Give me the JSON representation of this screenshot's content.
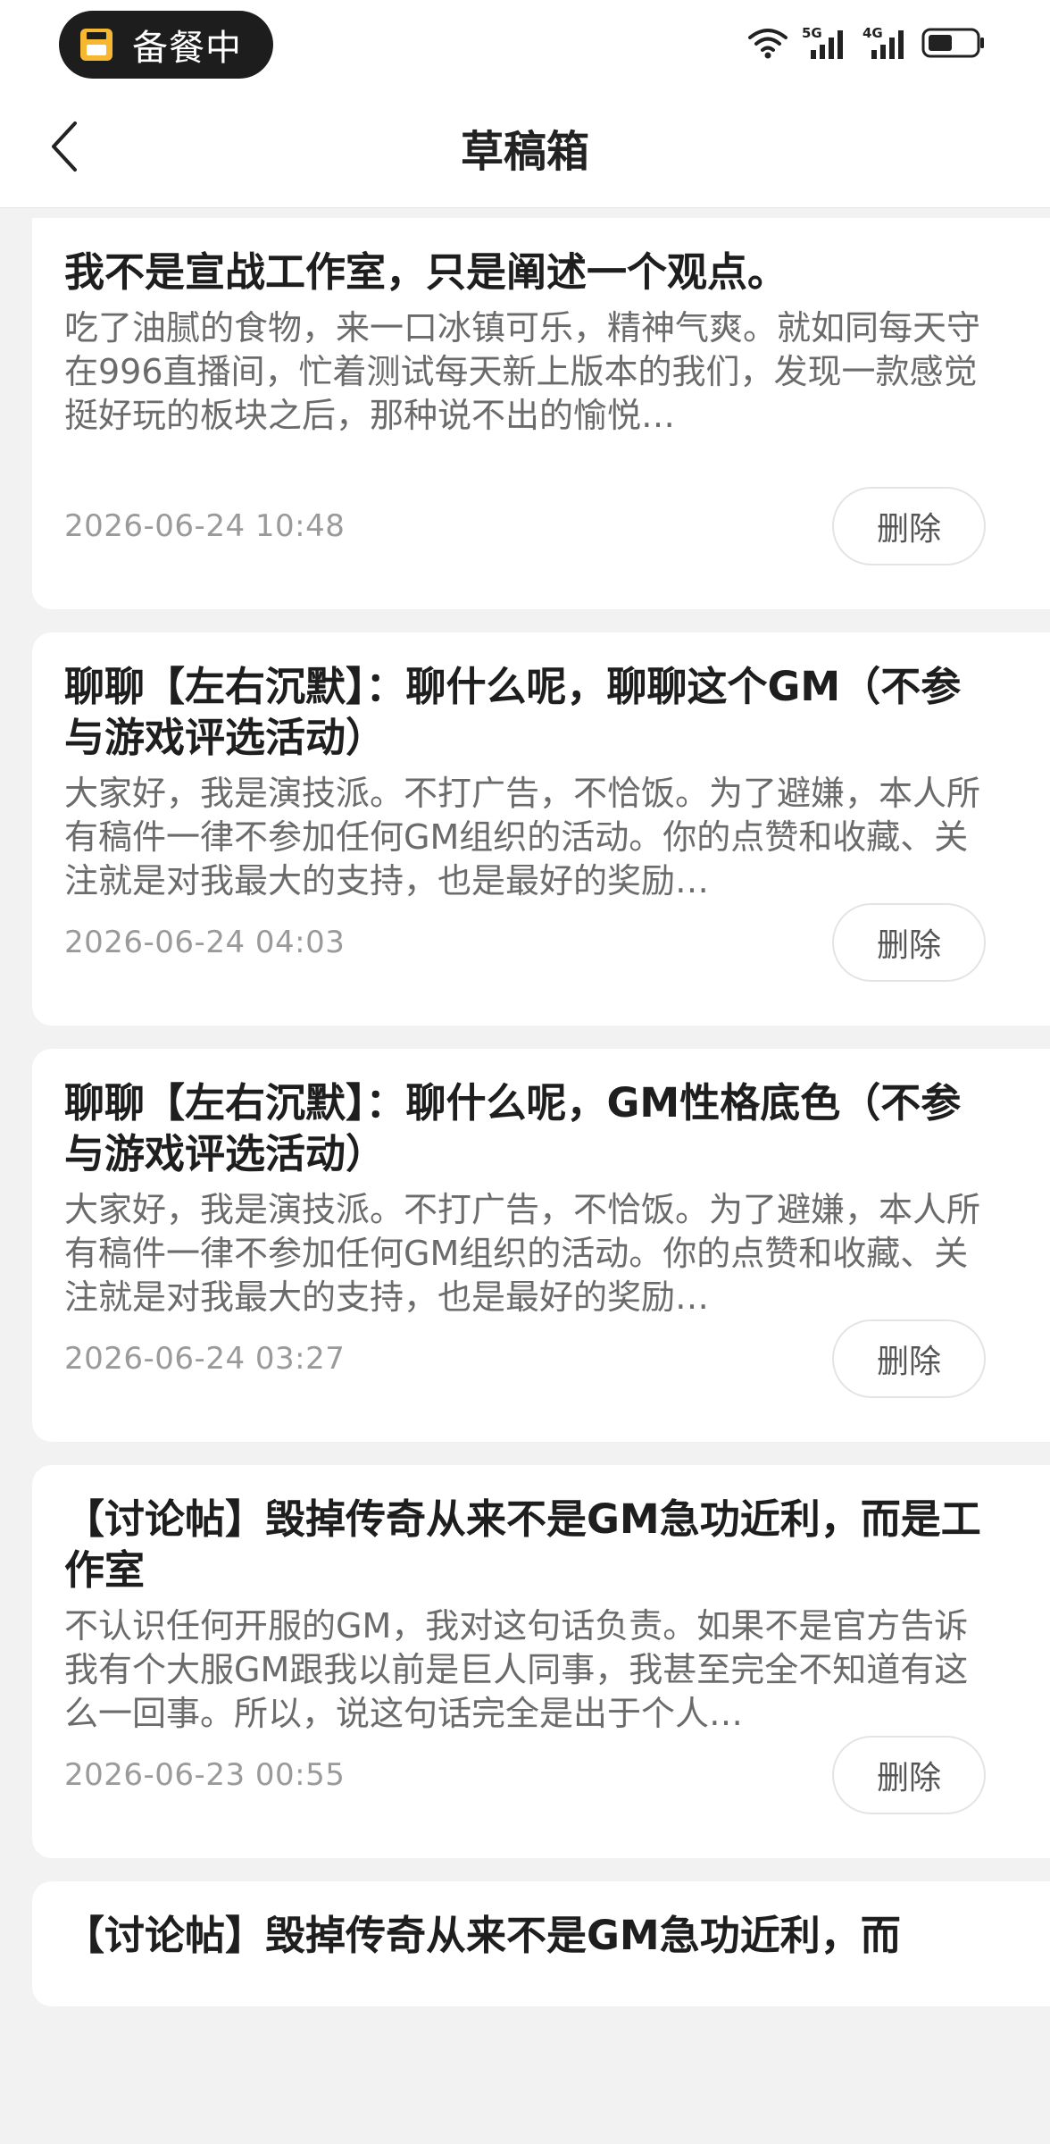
{
  "status_bar": {
    "pill_label": "备餐中",
    "network_5g": "5G",
    "network_4g": "4G"
  },
  "nav": {
    "title": "草稿箱"
  },
  "drafts": [
    {
      "title": "我不是宣战工作室，只是阐述一个观点。",
      "excerpt": "吃了油腻的食物，来一口冰镇可乐，精神气爽。就如同每天守在996直播间，忙着测试每天新上版本的我们，发现一款感觉挺好玩的板块之后，那种说不出的愉悦…",
      "time": "2026-06-24 10:48",
      "delete_label": "删除"
    },
    {
      "title": "聊聊【左右沉默】：聊什么呢，聊聊这个GM（不参与游戏评选活动）",
      "excerpt": "大家好，我是演技派。不打广告，不恰饭。为了避嫌，本人所有稿件一律不参加任何GM组织的活动。你的点赞和收藏、关注就是对我最大的支持，也是最好的奖励…",
      "time": "2026-06-24 04:03",
      "delete_label": "删除"
    },
    {
      "title": "聊聊【左右沉默】：聊什么呢，GM性格底色（不参与游戏评选活动）",
      "excerpt": "大家好，我是演技派。不打广告，不恰饭。为了避嫌，本人所有稿件一律不参加任何GM组织的活动。你的点赞和收藏、关注就是对我最大的支持，也是最好的奖励…",
      "time": "2026-06-24 03:27",
      "delete_label": "删除"
    },
    {
      "title": "【讨论帖】毁掉传奇从来不是GM急功近利，而是工作室",
      "excerpt": "不认识任何开服的GM，我对这句话负责。如果不是官方告诉我有个大服GM跟我以前是巨人同事，我甚至完全不知道有这么一回事。所以，说这句话完全是出于个人…",
      "time": "2026-06-23 00:55",
      "delete_label": "删除"
    },
    {
      "title": "【讨论帖】毁掉传奇从来不是GM急功近利，而"
    }
  ]
}
